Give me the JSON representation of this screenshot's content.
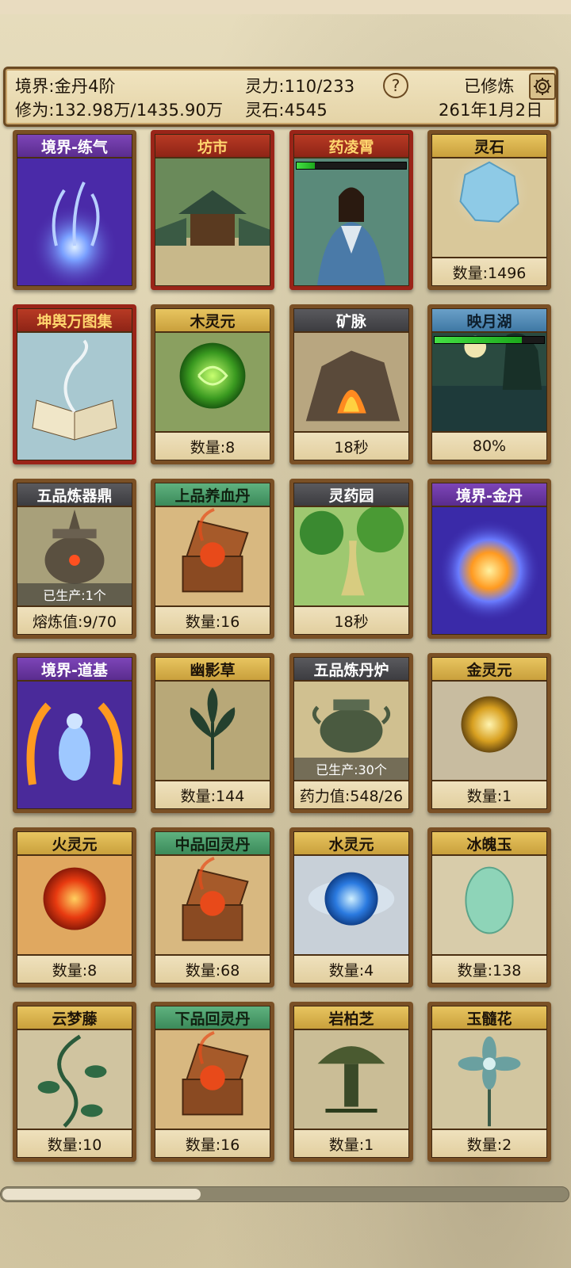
{
  "header": {
    "realm": "境界:金丹4阶",
    "cultivation": "修为:132.98万/1435.90万",
    "spirit_power": "灵力:110/233",
    "spirit_stone": "灵石:4545",
    "help": "?",
    "status": "已修炼",
    "date": "261年1月2日"
  },
  "cards": [
    {
      "title": "境界-练气",
      "style": "purple",
      "art": "realm-qi",
      "footer": ""
    },
    {
      "title": "坊市",
      "style": "redt",
      "art": "market",
      "footer": ""
    },
    {
      "title": "药凌霄",
      "style": "redt",
      "art": "person",
      "footer": "",
      "hp": 0.17
    },
    {
      "title": "灵石",
      "style": "gold",
      "art": "stone",
      "footer": "数量:1496"
    },
    {
      "title": "坤舆万图集",
      "style": "redt",
      "art": "book",
      "footer": ""
    },
    {
      "title": "木灵元",
      "style": "gold",
      "art": "wood-orb",
      "footer": "数量:8"
    },
    {
      "title": "矿脉",
      "style": "dark",
      "art": "mine",
      "footer": "18秒"
    },
    {
      "title": "映月湖",
      "style": "blue",
      "art": "lake",
      "footer": "80%",
      "hp": 0.8
    },
    {
      "title": "五品炼器鼎",
      "style": "dark",
      "art": "cauldron",
      "overlay": "已生产:1个",
      "footer": "熔炼值:9/70"
    },
    {
      "title": "上品养血丹",
      "style": "green",
      "art": "chest",
      "footer": "数量:16"
    },
    {
      "title": "灵药园",
      "style": "dark",
      "art": "garden",
      "footer": "18秒"
    },
    {
      "title": "境界-金丹",
      "style": "purple",
      "art": "realm-gold",
      "footer": ""
    },
    {
      "title": "境界-道基",
      "style": "purple",
      "art": "realm-dao",
      "footer": ""
    },
    {
      "title": "幽影草",
      "style": "gold",
      "art": "herb-dark",
      "footer": "数量:144"
    },
    {
      "title": "五品炼丹炉",
      "style": "dark",
      "art": "furnace",
      "overlay": "已生产:30个",
      "footer": "药力值:548/26"
    },
    {
      "title": "金灵元",
      "style": "gold",
      "art": "gold-orb",
      "footer": "数量:1"
    },
    {
      "title": "火灵元",
      "style": "gold",
      "art": "fire-orb",
      "footer": "数量:8"
    },
    {
      "title": "中品回灵丹",
      "style": "green",
      "art": "chest",
      "footer": "数量:68"
    },
    {
      "title": "水灵元",
      "style": "gold",
      "art": "water-orb",
      "footer": "数量:4"
    },
    {
      "title": "冰魄玉",
      "style": "gold",
      "art": "jade",
      "footer": "数量:138"
    },
    {
      "title": "云梦藤",
      "style": "gold",
      "art": "vine",
      "footer": "数量:10"
    },
    {
      "title": "下品回灵丹",
      "style": "green",
      "art": "chest",
      "footer": "数量:16"
    },
    {
      "title": "岩柏芝",
      "style": "gold",
      "art": "mushroom",
      "footer": "数量:1"
    },
    {
      "title": "玉髓花",
      "style": "gold",
      "art": "flower",
      "footer": "数量:2"
    }
  ],
  "scroll_position": 0.0,
  "scroll_visible_fraction": 0.35
}
